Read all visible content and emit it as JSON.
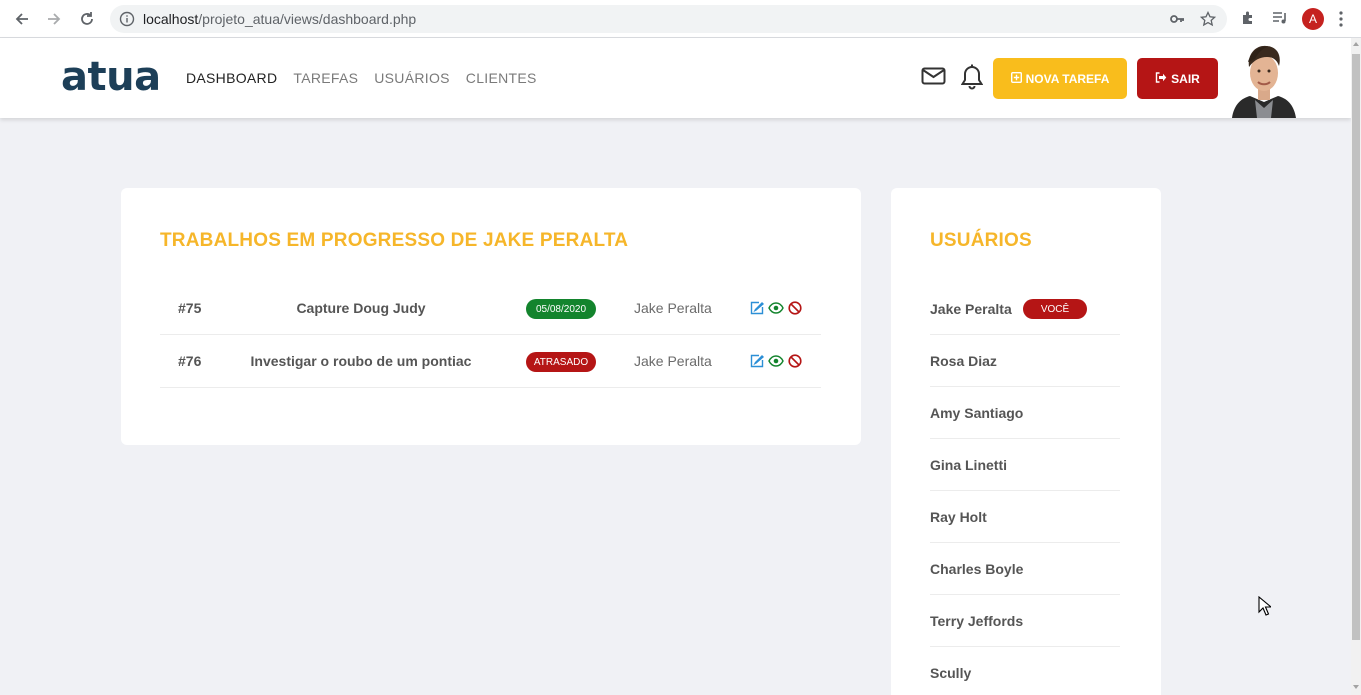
{
  "browser": {
    "url_host": "localhost",
    "url_path": "/projeto_atua/views/dashboard.php",
    "profile_initial": "A"
  },
  "header": {
    "logo": "atua",
    "nav": [
      {
        "label": "DASHBOARD",
        "active": true
      },
      {
        "label": "TAREFAS",
        "active": false
      },
      {
        "label": "USUÁRIOS",
        "active": false
      },
      {
        "label": "CLIENTES",
        "active": false
      }
    ],
    "new_task_label": "NOVA TAREFA",
    "exit_label": "SAIR",
    "icons": [
      "envelope-icon",
      "bell-icon",
      "plus-square-icon",
      "sign-out-icon"
    ]
  },
  "work_card": {
    "title": "TRABALHOS EM PROGRESSO DE JAKE PERALTA",
    "tasks": [
      {
        "id": "#75",
        "name": "Capture Doug Judy",
        "badge": "05/08/2020",
        "badge_color": "#13842d",
        "owner": "Jake Peralta"
      },
      {
        "id": "#76",
        "name": "Investigar o roubo de um pontiac",
        "badge": "ATRASADO",
        "badge_color": "#b51515",
        "owner": "Jake Peralta"
      }
    ],
    "action_icons": [
      "edit-icon",
      "view-icon",
      "block-icon"
    ]
  },
  "users_card": {
    "title": "USUÁRIOS",
    "you_badge": "VOCÊ",
    "users": [
      {
        "name": "Jake Peralta"
      },
      {
        "name": "Rosa Diaz"
      },
      {
        "name": "Amy Santiago"
      },
      {
        "name": "Gina Linetti"
      },
      {
        "name": "Ray Holt"
      },
      {
        "name": "Charles Boyle"
      },
      {
        "name": "Terry Jeffords"
      },
      {
        "name": "Scully"
      }
    ]
  },
  "colors": {
    "accent": "#f6b62a",
    "danger": "#b51515",
    "success": "#13842d",
    "logo": "#1d3f58"
  }
}
